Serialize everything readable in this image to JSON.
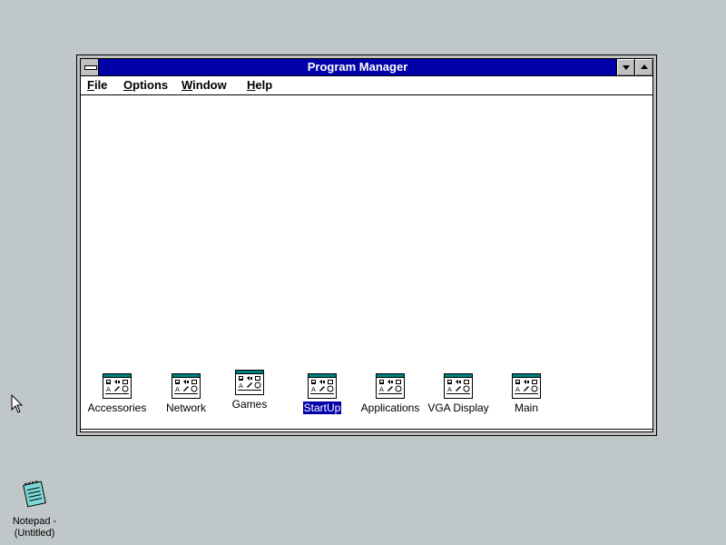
{
  "window": {
    "title": "Program Manager"
  },
  "menubar": {
    "items": [
      {
        "mnemonic": "F",
        "rest": "ile"
      },
      {
        "mnemonic": "O",
        "rest": "ptions"
      },
      {
        "mnemonic": "W",
        "rest": "indow"
      },
      {
        "mnemonic": "H",
        "rest": "elp"
      }
    ]
  },
  "groups": [
    {
      "label": "Accessories",
      "icon": "program-group-icon",
      "selected": false
    },
    {
      "label": "Network",
      "icon": "program-group-icon",
      "selected": false
    },
    {
      "label": "Games",
      "icon": "program-group-icon",
      "selected": false
    },
    {
      "label": "StartUp",
      "icon": "program-group-icon",
      "selected": true
    },
    {
      "label": "Applications",
      "icon": "program-group-icon",
      "selected": false
    },
    {
      "label": "VGA Display",
      "icon": "program-group-icon",
      "selected": false
    },
    {
      "label": "Main",
      "icon": "program-group-icon",
      "selected": false
    }
  ],
  "desktop": {
    "notepad": {
      "line1": "Notepad -",
      "line2": "(Untitled)",
      "icon": "notepad-icon"
    }
  },
  "colors": {
    "desktop": "#c0c7c8",
    "titlebar": "#0000a8",
    "selection": "#0000a8"
  }
}
